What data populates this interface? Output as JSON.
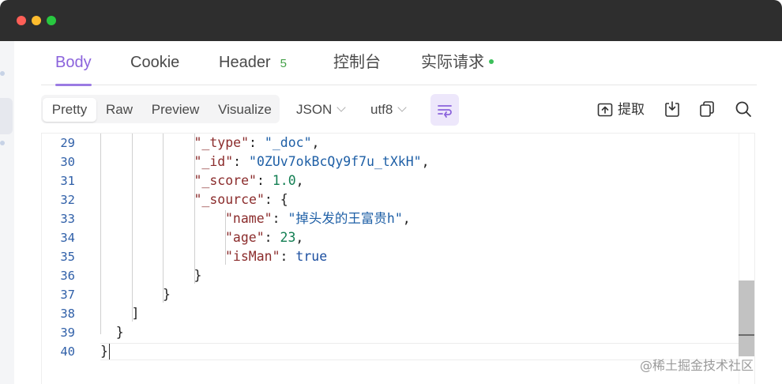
{
  "tabs": [
    {
      "label": "Body",
      "active": true
    },
    {
      "label": "Cookie"
    },
    {
      "label": "Header",
      "badge": "5"
    },
    {
      "label": "控制台"
    },
    {
      "label": "实际请求",
      "status_dot": true
    }
  ],
  "view_modes": [
    {
      "label": "Pretty",
      "active": true
    },
    {
      "label": "Raw"
    },
    {
      "label": "Preview"
    },
    {
      "label": "Visualize"
    }
  ],
  "format_dropdown": {
    "value": "JSON"
  },
  "encoding_dropdown": {
    "value": "utf8"
  },
  "toolbar_actions": {
    "extract_label": "提取",
    "icons": [
      "wrap-icon",
      "extract-icon",
      "download-icon",
      "copy-icon",
      "search-icon"
    ]
  },
  "editor": {
    "lines": [
      {
        "no": "29",
        "tokens": [
          [
            "key",
            "\"_type\""
          ],
          [
            "pun",
            ": "
          ],
          [
            "str",
            "\"_doc\""
          ],
          [
            "pun",
            ","
          ]
        ]
      },
      {
        "no": "30",
        "tokens": [
          [
            "key",
            "\"_id\""
          ],
          [
            "pun",
            ": "
          ],
          [
            "str",
            "\"0ZUv7okBcQy9f7u_tXkH\""
          ],
          [
            "pun",
            ","
          ]
        ]
      },
      {
        "no": "31",
        "tokens": [
          [
            "key",
            "\"_score\""
          ],
          [
            "pun",
            ": "
          ],
          [
            "num",
            "1.0"
          ],
          [
            "pun",
            ","
          ]
        ]
      },
      {
        "no": "32",
        "tokens": [
          [
            "key",
            "\"_source\""
          ],
          [
            "pun",
            ": {"
          ]
        ]
      },
      {
        "no": "33",
        "tokens": [
          [
            "key",
            "\"name\""
          ],
          [
            "pun",
            ": "
          ],
          [
            "str",
            "\"掉头发的王富贵h\""
          ],
          [
            "pun",
            ","
          ]
        ]
      },
      {
        "no": "34",
        "tokens": [
          [
            "key",
            "\"age\""
          ],
          [
            "pun",
            ": "
          ],
          [
            "num",
            "23"
          ],
          [
            "pun",
            ","
          ]
        ]
      },
      {
        "no": "35",
        "tokens": [
          [
            "key",
            "\"isMan\""
          ],
          [
            "pun",
            ": "
          ],
          [
            "bool",
            "true"
          ]
        ]
      },
      {
        "no": "36",
        "tokens": [
          [
            "pun",
            "}"
          ]
        ]
      },
      {
        "no": "37",
        "tokens": [
          [
            "pun",
            "}"
          ]
        ]
      },
      {
        "no": "38",
        "tokens": [
          [
            "pun",
            "]"
          ]
        ]
      },
      {
        "no": "39",
        "tokens": [
          [
            "pun",
            "}"
          ]
        ]
      },
      {
        "no": "40",
        "tokens": [
          [
            "pun",
            "}"
          ]
        ]
      }
    ],
    "current_line": "40"
  },
  "watermark": "@稀土掘金技术社区",
  "colors": {
    "accent": "#8b63dc",
    "key": "#8b2c2c",
    "string": "#1e5fa6",
    "number": "#127e52",
    "boolean": "#1c4fa0",
    "badge": "#43a047",
    "titlebar": "#2e2e2e"
  }
}
